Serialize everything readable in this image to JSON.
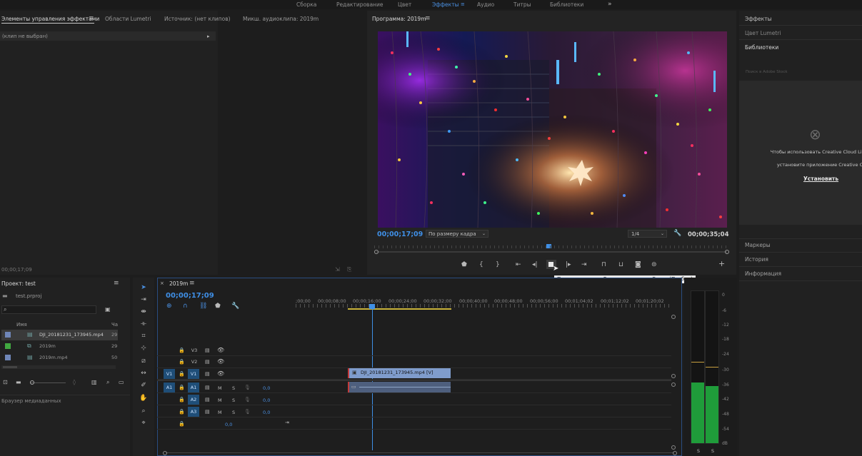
{
  "workspace_tabs": [
    {
      "label": "Сборка",
      "active": false
    },
    {
      "label": "Редактирование",
      "active": false
    },
    {
      "label": "Цвет",
      "active": false
    },
    {
      "label": "Эффекты",
      "active": true
    },
    {
      "label": "Аудио",
      "active": false
    },
    {
      "label": "Титры",
      "active": false
    },
    {
      "label": "Библиотеки",
      "active": false
    }
  ],
  "source_panel": {
    "tabs": [
      "Элементы управления эффектами",
      "Области Lumetri",
      "Источник: (нет клипов)",
      "Микш. аудиоклипа: 2019m"
    ],
    "clip_selector": "(клип не выбран)",
    "timecode": "00;00;17;09"
  },
  "program_monitor": {
    "title": "Программа: 2019m",
    "current_timecode": "00;00;17;09",
    "fit_option": "По размеру кадра",
    "resolution": "1/4",
    "duration": "00;00;35;04",
    "playhead_fraction": 0.49,
    "tooltip": "Переключатель «Воспроизведение-Стоп» (Пробел)"
  },
  "right_panel": {
    "tabs": [
      "Эффекты",
      "Цвет Lumetri",
      "Библиотеки"
    ],
    "search_placeholder": "Поиск в Adobe Stock",
    "message_line1": "Чтобы использовать Creative Cloud Libraries,",
    "message_line2": "установите приложение Creative Cloud",
    "install_link": "Установить",
    "bottom_items": [
      "Маркеры",
      "История",
      "Информация"
    ]
  },
  "project_panel": {
    "title": "Проект: test",
    "project_file": "test.prproj",
    "col_name": "Имя",
    "col_rate": "Ча",
    "items": [
      {
        "name": "DJI_20181231_173945.mp4",
        "rate": "29",
        "color": "#6f86b8",
        "selected": true
      },
      {
        "name": "2019m",
        "rate": "29",
        "color": "#41a841",
        "selected": false
      },
      {
        "name": "2019m.mp4",
        "rate": "50",
        "color": "#6f86b8",
        "selected": false
      }
    ],
    "media_browser": "Браузер медиаданных"
  },
  "timeline": {
    "sequence_name": "2019m",
    "timecode": "00;00;17;09",
    "ruler": [
      ";00;00",
      "00;00;08;00",
      "00;00;16;00",
      "00;00;24;00",
      "00;00;32;00",
      "00;00;40;00",
      "00;00;48;00",
      "00;00;56;00",
      "00;01;04;02",
      "00;01;12;02",
      "00;01;20;02"
    ],
    "video_tracks": [
      "V3",
      "V2",
      "V1"
    ],
    "audio_tracks": [
      "A1",
      "A2",
      "A3"
    ],
    "source_v": "V1",
    "source_a": "A1",
    "track_m": "M",
    "track_s": "S",
    "audio_volume": "0,0",
    "master_volume": "0,0",
    "video_clip_label": "DJI_20181231_173945.mp4 [V]"
  },
  "audio_meter": {
    "scale": [
      "0",
      "-6",
      "-12",
      "-18",
      "-24",
      "-30",
      "-36",
      "-42",
      "-48",
      "-54",
      "dB"
    ],
    "left_level_db": -36,
    "right_level_db": -36,
    "channel_labels": [
      "S",
      "S"
    ]
  }
}
